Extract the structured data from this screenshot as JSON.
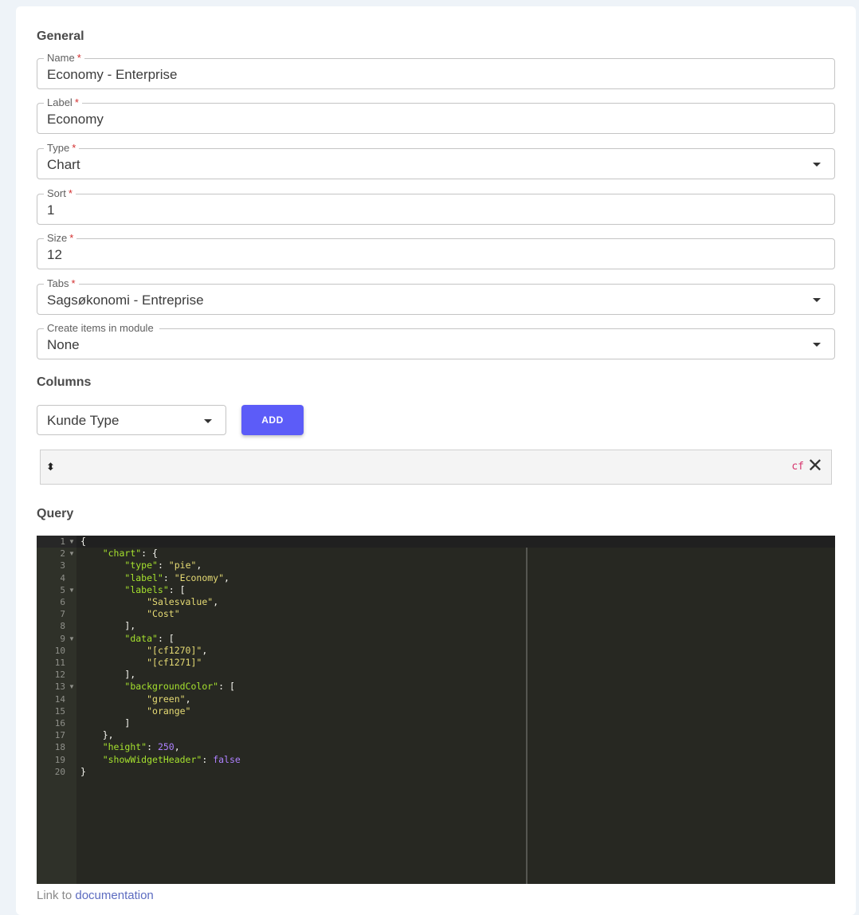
{
  "general": {
    "title": "General",
    "fields": [
      {
        "label": "Name",
        "required": "*",
        "value": "Economy - Enterprise"
      },
      {
        "label": "Label",
        "required": "*",
        "value": "Economy"
      },
      {
        "label": "Type",
        "required": "*",
        "value": "Chart"
      },
      {
        "label": "Sort",
        "required": "*",
        "value": "1"
      },
      {
        "label": "Size",
        "required": "*",
        "value": "12"
      },
      {
        "label": "Tabs",
        "required": "*",
        "value": "Sagsøkonomi - Entreprise"
      },
      {
        "label": "Create items in module",
        "required": "",
        "value": "None"
      }
    ]
  },
  "columns": {
    "title": "Columns",
    "select_value": "Kunde Type",
    "add_label": "ADD",
    "row": {
      "handle": "⬍",
      "code": "cf",
      "close": "✕"
    }
  },
  "query": {
    "title": "Query",
    "line_numbers": [
      "1",
      "2",
      "3",
      "4",
      "5",
      "6",
      "7",
      "8",
      "9",
      "10",
      "11",
      "12",
      "13",
      "14",
      "15",
      "16",
      "17",
      "18",
      "19",
      "20"
    ],
    "lines": [
      "{",
      "    \"chart\": {",
      "        \"type\": \"pie\",",
      "        \"label\": \"Economy\",",
      "        \"labels\": [",
      "            \"Salesvalue\",",
      "            \"Cost\"",
      "        ],",
      "        \"data\": [",
      "            \"[cf1270]\",",
      "            \"[cf1271]\"",
      "        ],",
      "        \"backgroundColor\": [",
      "            \"green\",",
      "            \"orange\"",
      "        ]",
      "    },",
      "    \"height\": 250,",
      "    \"showWidgetHeader\": false",
      "}"
    ]
  },
  "footer": {
    "prefix": "Link to",
    "link_text": "documentation"
  },
  "colors": {
    "accent": "#5c5cf8",
    "required": "#d32f2f",
    "editor_bg": "#272822"
  }
}
